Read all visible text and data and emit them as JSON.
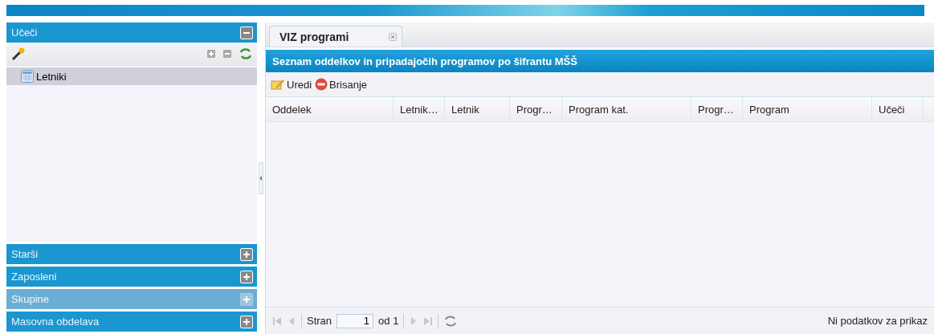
{
  "accordion": [
    {
      "title": "Učeči",
      "expanded": true,
      "disabled": false
    },
    {
      "title": "Starši",
      "expanded": false,
      "disabled": false
    },
    {
      "title": "Zaposleni",
      "expanded": false,
      "disabled": false
    },
    {
      "title": "Skupine",
      "expanded": false,
      "disabled": true
    },
    {
      "title": "Masovna obdelava",
      "expanded": false,
      "disabled": false
    }
  ],
  "tree": {
    "items": [
      {
        "label": "Letniki",
        "selected": true
      }
    ]
  },
  "tabs": [
    {
      "label": "VIZ programi",
      "selected": true
    }
  ],
  "grid": {
    "title": "Seznam oddelkov in pripadajočih programov po šifrantu MŠŠ",
    "toolbar": [
      {
        "label": "Uredi",
        "kind": "edit"
      },
      {
        "label": "Brisanje",
        "kind": "delete"
      }
    ],
    "columns": [
      {
        "label": "Oddelek"
      },
      {
        "label": "Letnik…"
      },
      {
        "label": "Letnik"
      },
      {
        "label": "Progr…"
      },
      {
        "label": "Program kat."
      },
      {
        "label": "Progr…"
      },
      {
        "label": "Program"
      },
      {
        "label": "Učeči"
      }
    ]
  },
  "pager": {
    "page_label": "Stran",
    "page": "1",
    "of_label": "od 1",
    "status": "Ni podatkov za prikaz"
  }
}
